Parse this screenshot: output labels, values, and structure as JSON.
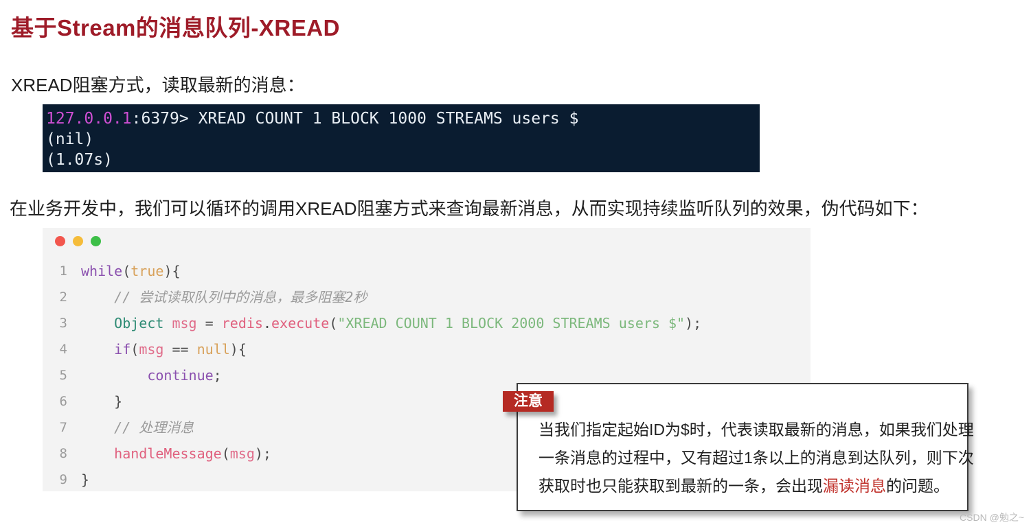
{
  "page": {
    "title": "基于Stream的消息队列-XREAD",
    "intro_line": "XREAD阻塞方式，读取最新的消息：",
    "paragraph": "在业务开发中，我们可以循环的调用XREAD阻塞方式来查询最新消息，从而实现持续监听队列的效果，伪代码如下：",
    "watermark": "CSDN @勉之~"
  },
  "terminal": {
    "prompt_ip": "127.0.0.1",
    "prompt_port": ":6379> ",
    "command": "XREAD COUNT 1 BLOCK 1000 STREAMS users $",
    "output_1": "(nil)",
    "output_2": "(1.07s)",
    "background": "#0a1c30",
    "ip_color": "#cf4fd4"
  },
  "code_card": {
    "window_dots": [
      "red",
      "yellow",
      "green"
    ],
    "lines": [
      {
        "num": "1",
        "text": "while(true){"
      },
      {
        "num": "2",
        "text": "    // 尝试读取队列中的消息，最多阻塞2秒"
      },
      {
        "num": "3",
        "text": "    Object msg = redis.execute(\"XREAD COUNT 1 BLOCK 2000 STREAMS users $\");"
      },
      {
        "num": "4",
        "text": "    if(msg == null){"
      },
      {
        "num": "5",
        "text": "        continue;"
      },
      {
        "num": "6",
        "text": "    }"
      },
      {
        "num": "7",
        "text": "    // 处理消息"
      },
      {
        "num": "8",
        "text": "    handleMessage(msg);"
      },
      {
        "num": "9",
        "text": "}"
      }
    ]
  },
  "callout": {
    "tag": "注意",
    "tag_color": "#b52a23",
    "line_1": "当我们指定起始ID为$时，代表读取最新的消息，如果我们处理",
    "line_2": "一条消息的过程中，又有超过1条以上的消息到达队列，则下次",
    "line_3_pre": "获取时也只能获取到最新的一条，会出现",
    "line_3_highlight": "漏读消息",
    "line_3_post": "的问题。",
    "highlight_color": "#c0312b"
  }
}
